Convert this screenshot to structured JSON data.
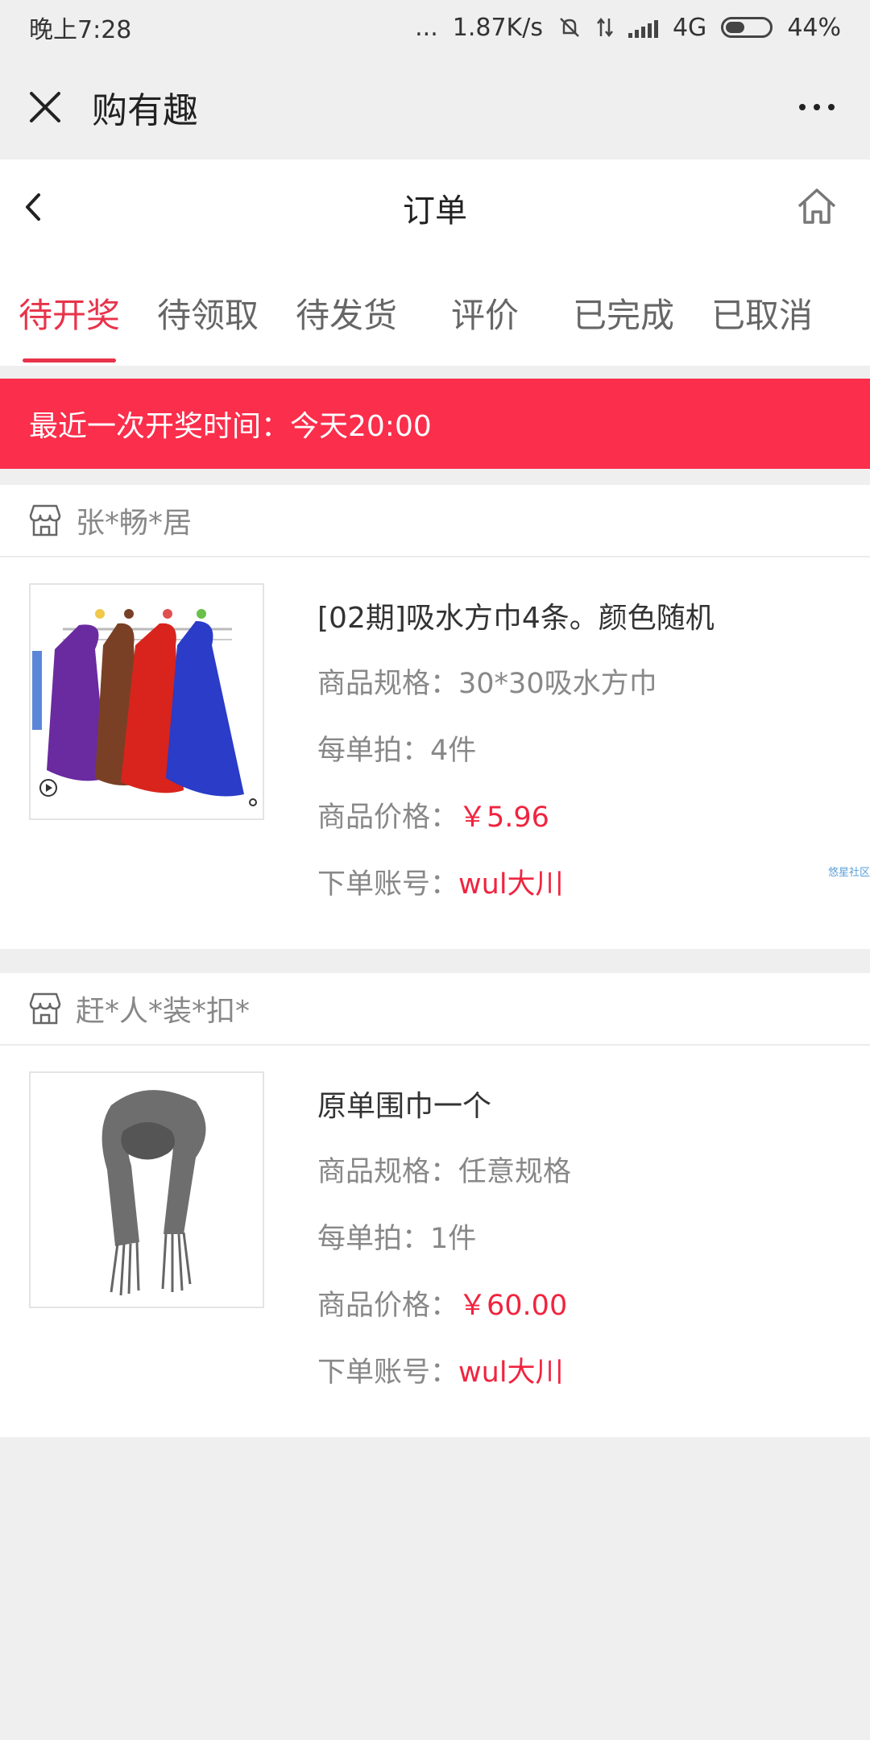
{
  "status_bar": {
    "time": "晚上7:28",
    "dots": "...",
    "speed": "1.87K/s",
    "network": "4G",
    "battery": "44%",
    "battery_level": 0.44
  },
  "title_bar": {
    "app_title": "购有趣"
  },
  "header": {
    "title": "订单"
  },
  "tabs": [
    {
      "label": "待开奖",
      "active": true
    },
    {
      "label": "待领取"
    },
    {
      "label": "待发货"
    },
    {
      "label": "评价"
    },
    {
      "label": "已完成"
    },
    {
      "label": "已取消"
    }
  ],
  "banner": {
    "text": "最近一次开奖时间：今天20:00"
  },
  "orders": [
    {
      "shop": "张*畅*居",
      "title": "[02期]吸水方巾4条。颜色随机",
      "spec_label": "商品规格：",
      "spec": "30*30吸水方巾",
      "qty_label": "每单拍：",
      "qty": "4件",
      "price_label": "商品价格：",
      "price": "￥5.96",
      "account_label": "下单账号：",
      "account": "wul大川",
      "watermark": "悠星社区"
    },
    {
      "shop": "赶*人*装*扣*",
      "title": "原单围巾一个",
      "spec_label": "商品规格：",
      "spec": "任意规格",
      "qty_label": "每单拍：",
      "qty": "1件",
      "price_label": "商品价格：",
      "price": "￥60.00",
      "account_label": "下单账号：",
      "account": "wul大川"
    }
  ],
  "colors": {
    "accent": "#e8334a",
    "banner": "#fb2e4b",
    "price": "#f0243f"
  }
}
